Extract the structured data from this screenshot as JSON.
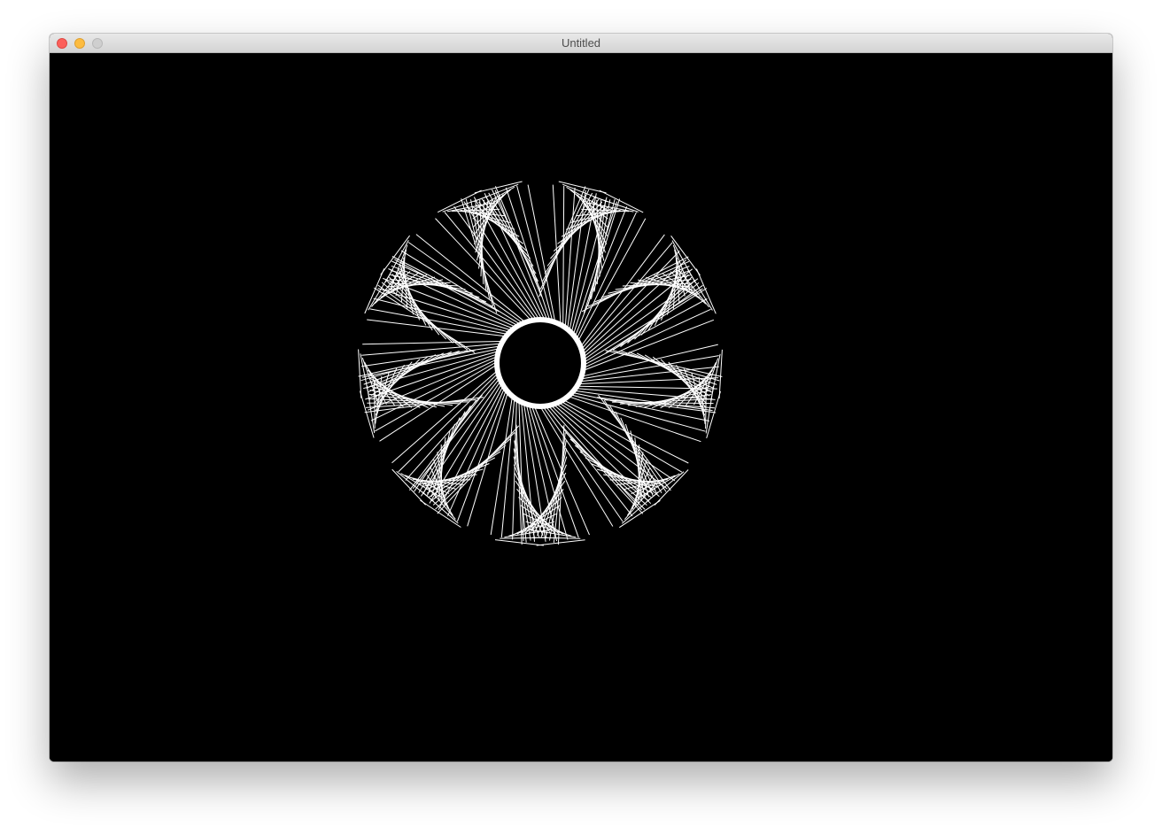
{
  "window": {
    "title": "Untitled",
    "controls": {
      "close": "close-icon",
      "minimize": "minimize-icon",
      "zoom": "zoom-icon"
    }
  },
  "canvas": {
    "background": "#000000",
    "stroke_color": "#ffffff",
    "fill_color": "#ffffff",
    "pattern": "string-art-rosette",
    "petals": 9
  }
}
